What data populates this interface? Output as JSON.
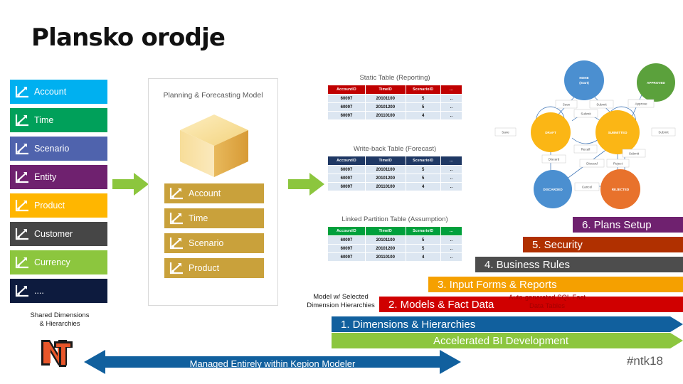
{
  "slide": {
    "title": "Plansko orodje",
    "hashtag": "#ntk18"
  },
  "dimensions": {
    "heading": "Shared Dimensions\n& Hierarchies",
    "items": [
      {
        "label": "Account",
        "color": "#00b0f0"
      },
      {
        "label": "Time",
        "color": "#00a05a"
      },
      {
        "label": "Scenario",
        "color": "#4f63ad"
      },
      {
        "label": "Entity",
        "color": "#6f216f"
      },
      {
        "label": "Product",
        "color": "#ffb600"
      },
      {
        "label": "Customer",
        "color": "#464646"
      },
      {
        "label": "Currency",
        "color": "#8cc63e"
      },
      {
        "label": "....",
        "color": "#0d1b3e"
      }
    ]
  },
  "model_panel": {
    "title": "Planning &\nForecasting Model",
    "chip_color": "#c9a13b",
    "items": [
      {
        "label": "Account"
      },
      {
        "label": "Time"
      },
      {
        "label": "Scenario"
      },
      {
        "label": "Product"
      }
    ]
  },
  "tables": [
    {
      "caption": "Static Table (Reporting)",
      "header_color": "#c00000",
      "columns": [
        "AccountID",
        "TimeID",
        "ScenarioID",
        "..."
      ],
      "rows": [
        [
          "60097",
          "20101100",
          "5",
          ".."
        ],
        [
          "60097",
          "20101200",
          "5",
          ".."
        ],
        [
          "60097",
          "20110100",
          "4",
          ".."
        ]
      ]
    },
    {
      "caption": "Write-back Table (Forecast)",
      "header_color": "#1f3864",
      "columns": [
        "AccountID",
        "TimeID",
        "ScenarioID",
        "..."
      ],
      "rows": [
        [
          "60097",
          "20101100",
          "5",
          ".."
        ],
        [
          "60097",
          "20101200",
          "5",
          ".."
        ],
        [
          "60097",
          "20110100",
          "4",
          ".."
        ]
      ]
    },
    {
      "caption": "Linked Partition Table (Assumption)",
      "header_color": "#00a03c",
      "columns": [
        "AccountID",
        "TimeID",
        "ScenarioID",
        "..."
      ],
      "rows": [
        [
          "60097",
          "20101100",
          "5",
          ".."
        ],
        [
          "60097",
          "20101200",
          "5",
          ".."
        ],
        [
          "60097",
          "20110100",
          "4",
          ".."
        ]
      ]
    }
  ],
  "banners": [
    {
      "label": "6. Plans Setup",
      "color": "#6f216f"
    },
    {
      "label": "5. Security",
      "color": "#b03000"
    },
    {
      "label": "4. Business Rules",
      "color": "#4d4d4d"
    },
    {
      "label": "3. Input Forms & Reports",
      "color": "#f5a000"
    },
    {
      "label": "2. Models & Fact Data",
      "color": "#d00000"
    },
    {
      "label": "1. Dimensions & Hierarchies",
      "color": "#11609e"
    },
    {
      "label": "Accelerated BI Development",
      "color": "#8cc63e"
    }
  ],
  "annotations": {
    "model_selected": "Model w/ Selected\nDimension Hierarchies",
    "auto_sql": "Auto-generated SQL Fact\nData Tables",
    "managed": "Managed Entirely within Kepion Modeler"
  },
  "state_diagram": {
    "nodes": [
      {
        "id": "none",
        "label": "NONE\n(Start)",
        "color": "#4b8fd0"
      },
      {
        "id": "approved",
        "label": "APPROVED",
        "color": "#5ba13c"
      },
      {
        "id": "draft",
        "label": "DRAFT",
        "color": "#fbb615"
      },
      {
        "id": "submitted",
        "label": "SUBMITTED",
        "color": "#fbb615"
      },
      {
        "id": "discarded",
        "label": "DISCARDED",
        "color": "#4b8fd0"
      },
      {
        "id": "rejected",
        "label": "REJECTED",
        "color": "#e8722c"
      }
    ],
    "edges": [
      {
        "label": "Save"
      },
      {
        "label": "Submit"
      },
      {
        "label": "Submit"
      },
      {
        "label": "Approve"
      },
      {
        "label": "Save"
      },
      {
        "label": "Submit"
      },
      {
        "label": "Recall"
      },
      {
        "label": "Discard"
      },
      {
        "label": "Discard"
      },
      {
        "label": "Reject"
      },
      {
        "label": "Submit"
      },
      {
        "label": "Cancel"
      }
    ]
  }
}
